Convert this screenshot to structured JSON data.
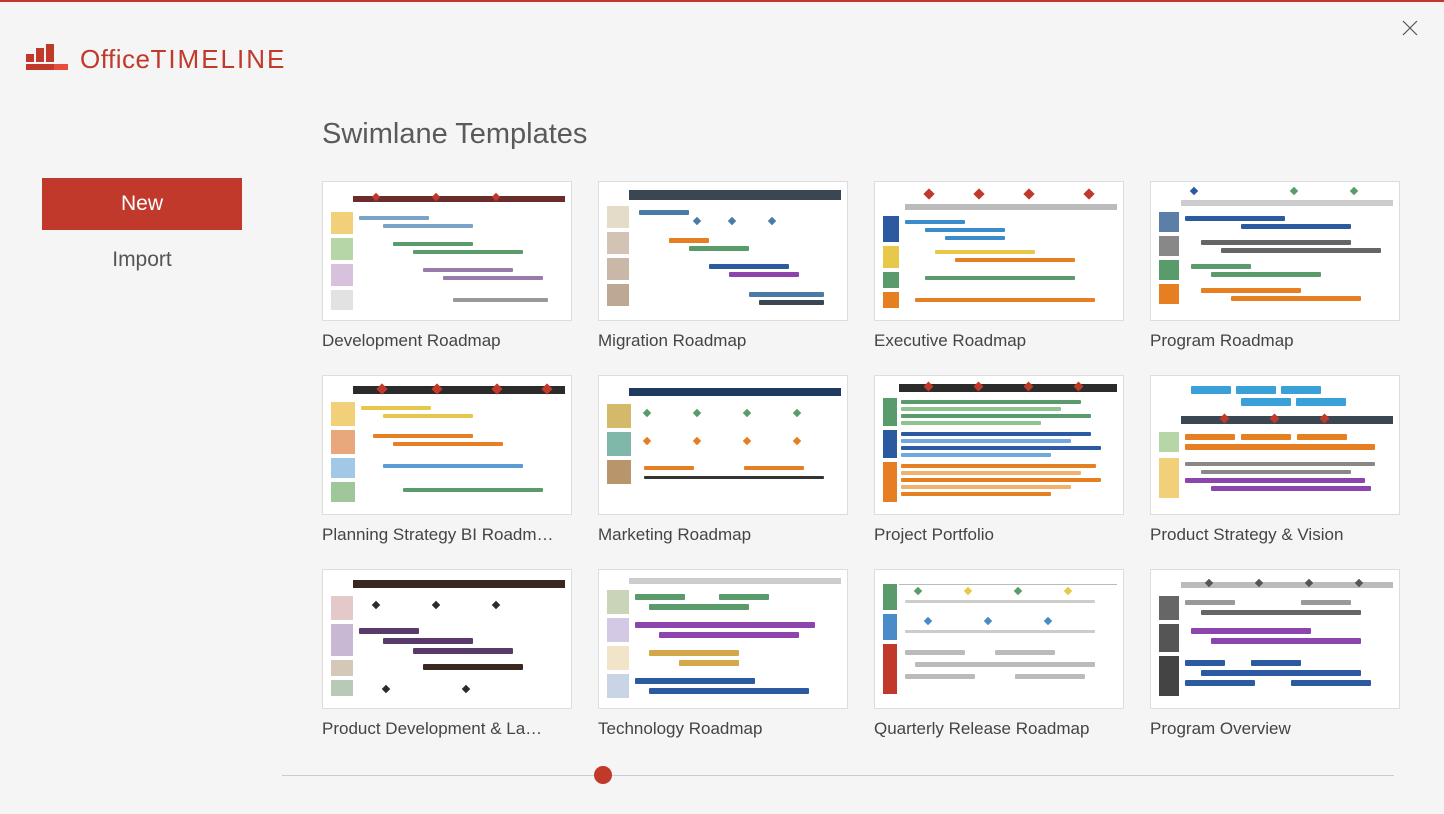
{
  "brand": {
    "office": "Office",
    "timeline": "TIMELINE"
  },
  "sidebar": {
    "new": "New",
    "import": "Import"
  },
  "page_title": "Swimlane Templates",
  "templates": [
    {
      "label": "Development Roadmap"
    },
    {
      "label": "Migration Roadmap"
    },
    {
      "label": "Executive Roadmap"
    },
    {
      "label": "Program Roadmap"
    },
    {
      "label": "Planning Strategy BI Roadm…"
    },
    {
      "label": "Marketing Roadmap"
    },
    {
      "label": "Project Portfolio"
    },
    {
      "label": "Product Strategy & Vision"
    },
    {
      "label": "Product Development & La…"
    },
    {
      "label": "Technology Roadmap"
    },
    {
      "label": "Quarterly Release Roadmap"
    },
    {
      "label": "Program Overview"
    }
  ],
  "colors": {
    "accent": "#c0392b"
  }
}
